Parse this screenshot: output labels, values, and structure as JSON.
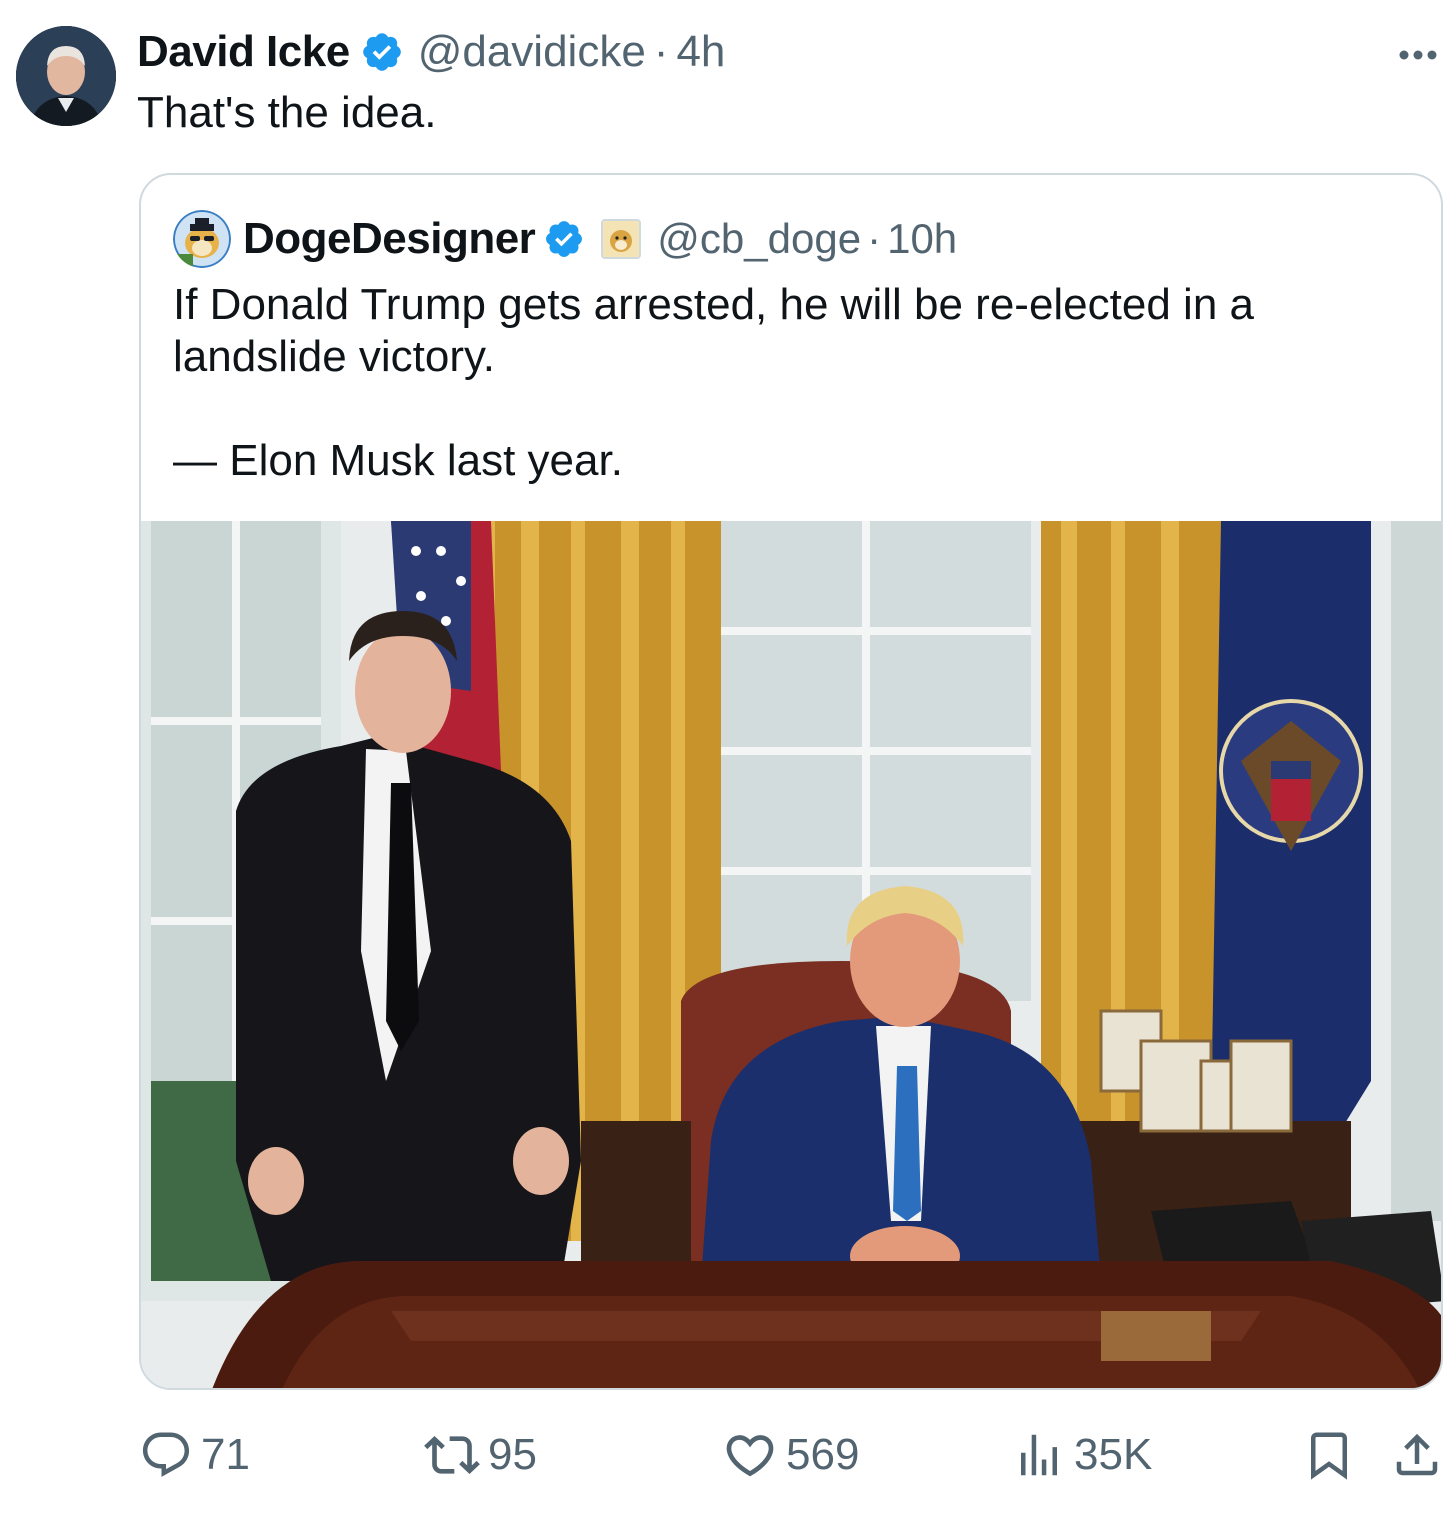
{
  "post": {
    "author_name": "David Icke",
    "author_handle": "@davidicke",
    "separator": "·",
    "time": "4h",
    "text": "That's the idea."
  },
  "quoted": {
    "author_name": "DogeDesigner",
    "author_handle": "@cb_doge",
    "separator": "·",
    "time": "10h",
    "text_line1": "If Donald Trump gets arrested, he will be re-elected in a landslide victory.",
    "text_line2": "— Elon Musk last year.",
    "image_description_icon": "photo"
  },
  "actions": {
    "replies": "71",
    "reposts": "95",
    "likes": "569",
    "views": "35K"
  },
  "icons": {
    "verified": "verified-badge-icon",
    "more": "more-icon",
    "reply": "reply-icon",
    "repost": "repost-icon",
    "like": "heart-icon",
    "views": "views-icon",
    "bookmark": "bookmark-icon",
    "share": "share-icon"
  },
  "colors": {
    "verified_blue": "#1d9bf0",
    "text_primary": "#0f1419",
    "text_secondary": "#536471",
    "border": "#cfd9de"
  }
}
